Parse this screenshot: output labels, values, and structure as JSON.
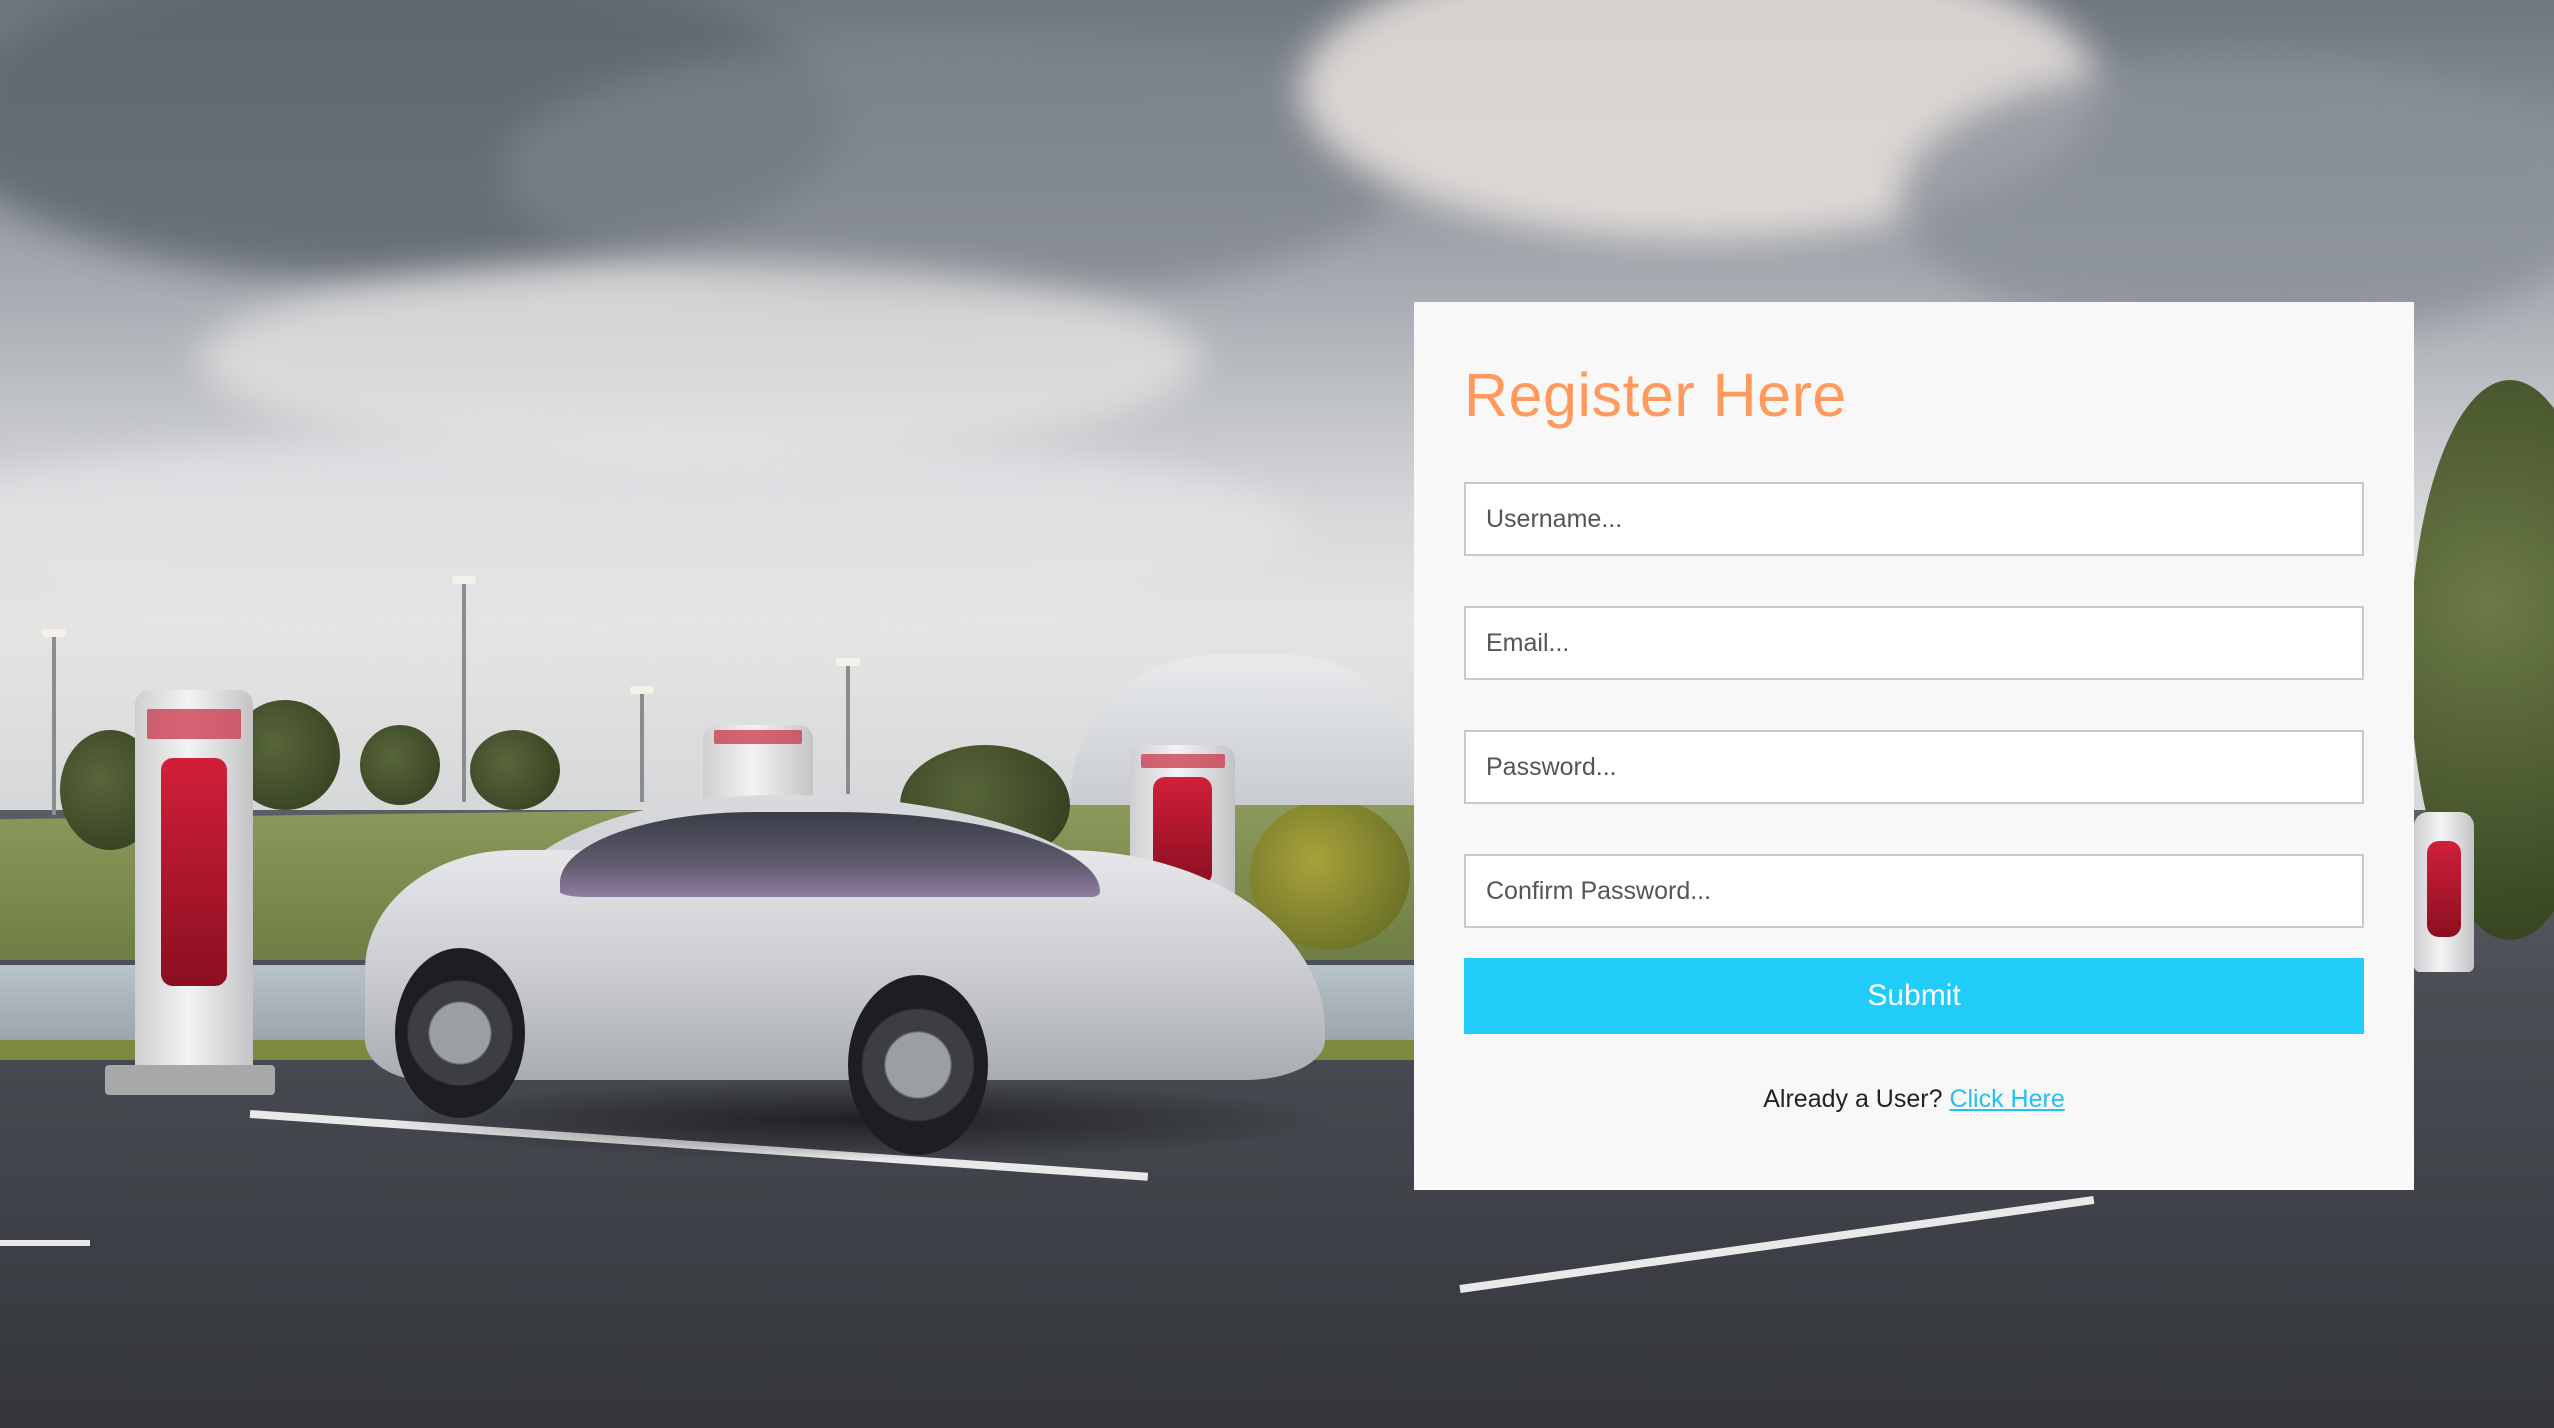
{
  "register": {
    "title": "Register Here",
    "fields": {
      "username": {
        "placeholder": "Username...",
        "value": ""
      },
      "email": {
        "placeholder": "Email...",
        "value": ""
      },
      "password": {
        "placeholder": "Password...",
        "value": ""
      },
      "confirm_password": {
        "placeholder": "Confirm Password...",
        "value": ""
      }
    },
    "submit_label": "Submit",
    "login_prompt": "Already a User?",
    "login_link": "Click Here"
  },
  "colors": {
    "title": "#ff9a5c",
    "submit_bg": "#22ccf8",
    "link": "#22c1ef",
    "card_bg": "#f8f8f8"
  },
  "background": {
    "icon": "car-photo"
  }
}
